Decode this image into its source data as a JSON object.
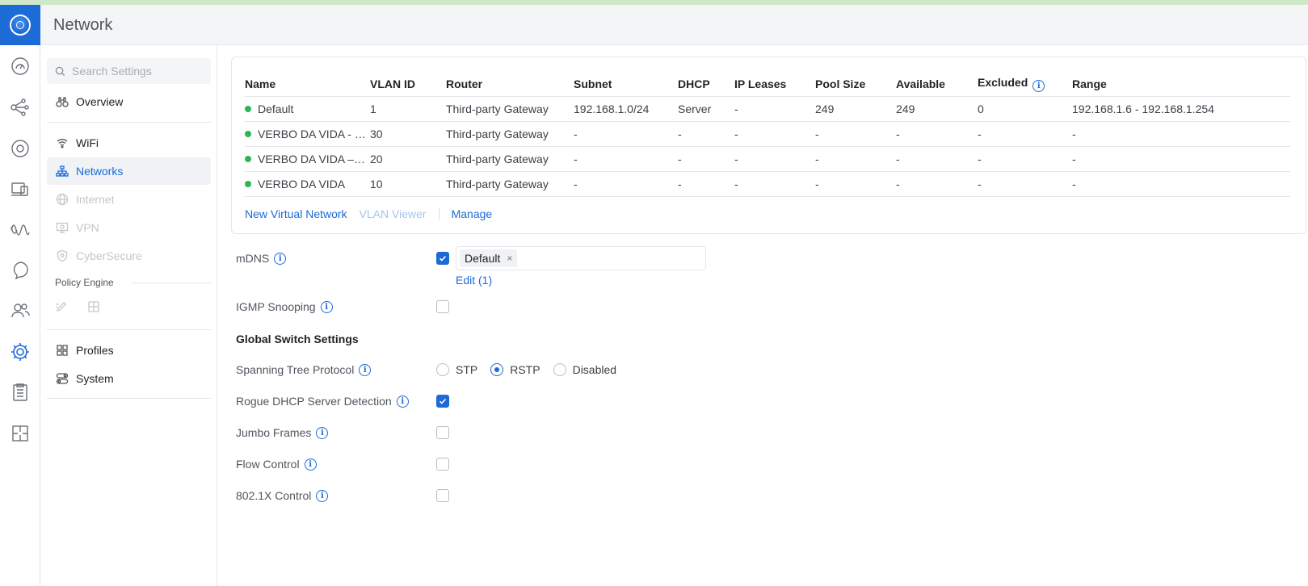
{
  "app": {
    "title": "Network"
  },
  "search": {
    "placeholder": "Search Settings"
  },
  "sidebar": {
    "items": [
      {
        "label": "Overview",
        "icon": "binoculars-icon"
      },
      {
        "label": "WiFi",
        "icon": "wifi-icon"
      },
      {
        "label": "Networks",
        "icon": "network-tree-icon",
        "active": true
      },
      {
        "label": "Internet",
        "icon": "globe-icon",
        "disabled": true
      },
      {
        "label": "VPN",
        "icon": "vpn-monitor-icon",
        "disabled": true
      },
      {
        "label": "CyberSecure",
        "icon": "shield-icon",
        "disabled": true
      }
    ],
    "policy_engine_label": "Policy Engine",
    "bottom_items": [
      {
        "label": "Profiles",
        "icon": "profiles-icon"
      },
      {
        "label": "System",
        "icon": "system-toggle-icon"
      }
    ]
  },
  "networks_table": {
    "columns": [
      "Name",
      "VLAN ID",
      "Router",
      "Subnet",
      "DHCP",
      "IP Leases",
      "Pool Size",
      "Available",
      "Excluded",
      "Range"
    ],
    "rows": [
      [
        "Default",
        "1",
        "Third-party Gateway",
        "192.168.1.0/24",
        "Server",
        "-",
        "249",
        "249",
        "0",
        "192.168.1.6 - 192.168.1.254"
      ],
      [
        "VERBO DA VIDA - …",
        "30",
        "Third-party Gateway",
        "-",
        "-",
        "-",
        "-",
        "-",
        "-",
        "-"
      ],
      [
        "VERBO DA VIDA –…",
        "20",
        "Third-party Gateway",
        "-",
        "-",
        "-",
        "-",
        "-",
        "-",
        "-"
      ],
      [
        "VERBO DA VIDA",
        "10",
        "Third-party Gateway",
        "-",
        "-",
        "-",
        "-",
        "-",
        "-",
        "-"
      ]
    ],
    "actions": {
      "new_virtual_network": "New Virtual Network",
      "vlan_viewer": "VLAN Viewer",
      "manage": "Manage"
    }
  },
  "settings": {
    "mdns": {
      "label": "mDNS",
      "checked": true,
      "tag": "Default",
      "edit": "Edit (1)"
    },
    "igmp": {
      "label": "IGMP Snooping",
      "checked": false
    },
    "global_switch_heading": "Global Switch Settings",
    "stp": {
      "label": "Spanning Tree Protocol",
      "options": [
        "STP",
        "RSTP",
        "Disabled"
      ],
      "selected": "RSTP"
    },
    "rogue_dhcp": {
      "label": "Rogue DHCP Server Detection",
      "checked": true
    },
    "jumbo": {
      "label": "Jumbo Frames",
      "checked": false
    },
    "flow": {
      "label": "Flow Control",
      "checked": false
    },
    "dot1x": {
      "label": "802.1X Control",
      "checked": false
    }
  },
  "colors": {
    "accent": "#1b6ad8",
    "status_ok": "#2fb457",
    "logo_bg": "#1c6bd6"
  }
}
